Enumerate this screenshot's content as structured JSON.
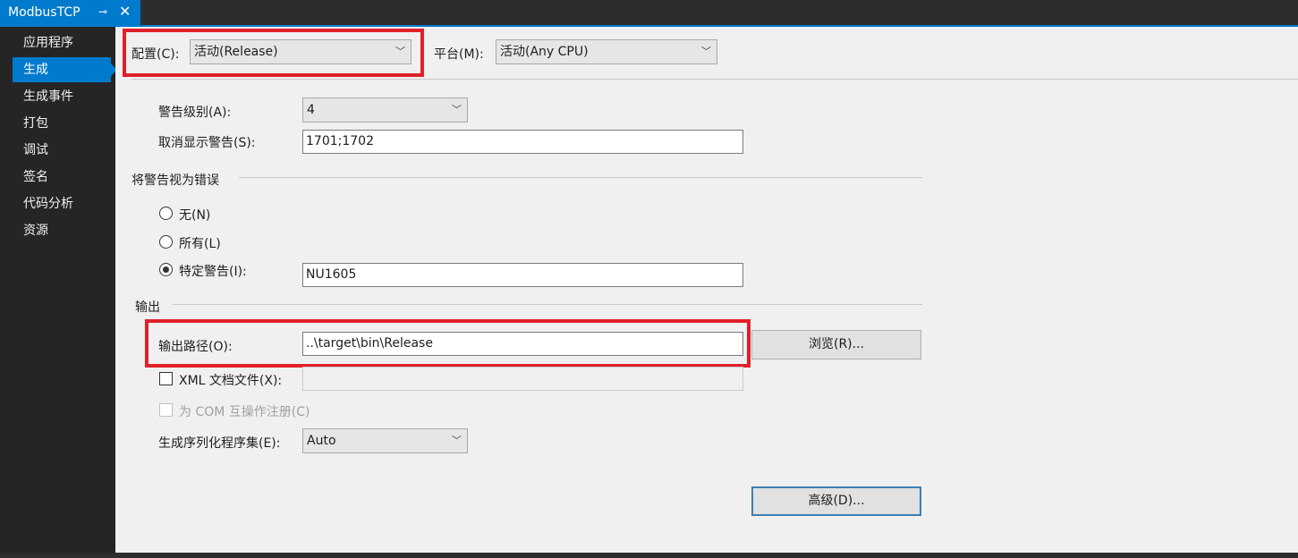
{
  "tab": {
    "title": "ModbusTCP",
    "pin_glyph": "⊸",
    "close_glyph": "✕"
  },
  "sidebar": {
    "items": [
      {
        "label": "应用程序",
        "active": false
      },
      {
        "label": "生成",
        "active": true
      },
      {
        "label": "生成事件",
        "active": false
      },
      {
        "label": "打包",
        "active": false
      },
      {
        "label": "调试",
        "active": false
      },
      {
        "label": "签名",
        "active": false
      },
      {
        "label": "代码分析",
        "active": false
      },
      {
        "label": "资源",
        "active": false
      }
    ]
  },
  "config": {
    "label": "配置(C):",
    "value": "活动(Release)"
  },
  "platform": {
    "label": "平台(M):",
    "value": "活动(Any CPU)"
  },
  "errors_warnings": {
    "warning_level_label": "警告级别(A):",
    "warning_level_value": "4",
    "suppress_label": "取消显示警告(S):",
    "suppress_value": "1701;1702"
  },
  "treat_warnings": {
    "section_title": "将警告视为错误",
    "none_label": "无(N)",
    "all_label": "所有(L)",
    "specific_label": "特定警告(I):",
    "specific_value": "NU1605",
    "selected": "specific"
  },
  "output": {
    "section_title": "输出",
    "path_label": "输出路径(O):",
    "path_value": "..\\target\\bin\\Release",
    "browse_label": "浏览(R)...",
    "xml_doc_label": "XML 文档文件(X):",
    "xml_doc_checked": false,
    "com_interop_label": "为 COM 互操作注册(C)",
    "com_interop_checked": false,
    "serialization_label": "生成序列化程序集(E):",
    "serialization_value": "Auto",
    "advanced_label": "高级(D)..."
  },
  "colors": {
    "accent": "#007acc",
    "highlight_box": "#e0202a",
    "panel_bg": "#f0f0f0"
  },
  "icons": {
    "dropdown": "chevron-down-icon"
  }
}
